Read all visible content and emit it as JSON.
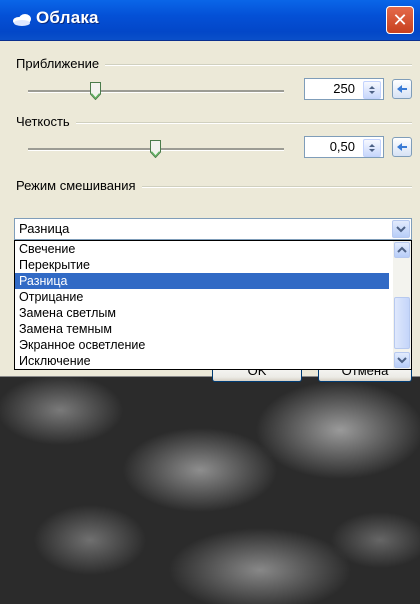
{
  "window": {
    "title": "Облака",
    "close_label": "✕"
  },
  "zoom": {
    "label": "Приближение",
    "value": "250"
  },
  "sharpness": {
    "label": "Четкость",
    "value": "0,50"
  },
  "blend": {
    "label": "Режим смешивания",
    "selected": "Разница",
    "options": [
      "Свечение",
      "Перекрытие",
      "Разница",
      "Отрицание",
      "Замена светлым",
      "Замена темным",
      "Экранное осветление",
      "Исключение"
    ],
    "highlighted_index": 2
  },
  "buttons": {
    "ok": "OK",
    "cancel": "Отмена"
  },
  "colors": {
    "titlebar": "#0450d6",
    "selection": "#316ac5",
    "close": "#c7401e"
  }
}
